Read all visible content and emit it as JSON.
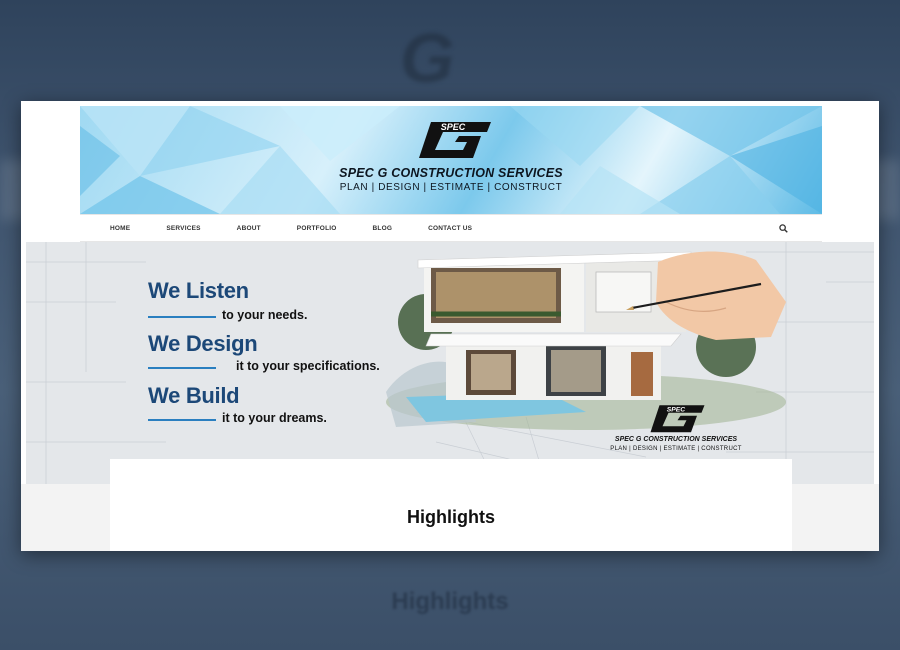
{
  "brand": {
    "logo_text": "SPEC",
    "company_name": "SPEC G CONSTRUCTION SERVICES",
    "tagline": "PLAN | DESIGN | ESTIMATE | CONSTRUCT"
  },
  "nav": {
    "items": [
      "HOME",
      "SERVICES",
      "ABOUT",
      "PORTFOLIO",
      "BLOG",
      "CONTACT US"
    ],
    "search_icon": "search-icon"
  },
  "hero": {
    "slogans": [
      {
        "big": "We Listen",
        "small": "to your needs."
      },
      {
        "big": "We Design",
        "small": "it to your specifications."
      },
      {
        "big": "We Build",
        "small": "it to your dreams."
      }
    ],
    "logo_text": "SPEC",
    "company_name": "SPEC G CONSTRUCTION SERVICES",
    "tagline": "PLAN | DESIGN | ESTIMATE | CONSTRUCT"
  },
  "content": {
    "title": "Highlights"
  },
  "colors": {
    "backdrop": "#3d5069",
    "slogan_blue": "#1c4878",
    "accent_line": "#2a7fc0"
  }
}
